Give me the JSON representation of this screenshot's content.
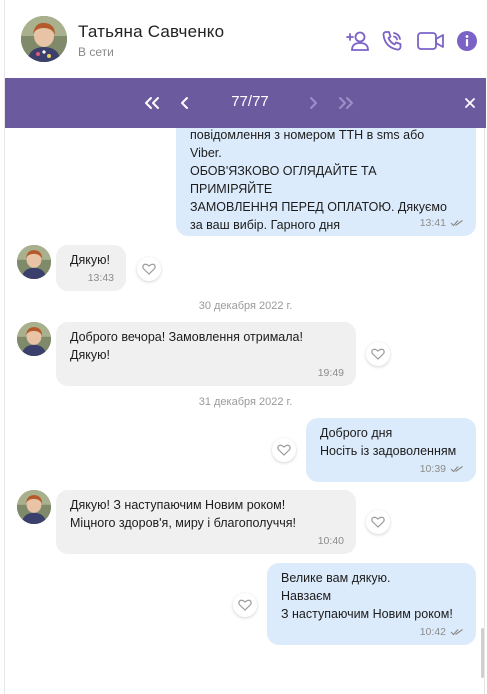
{
  "header": {
    "contact_name": "Татьяна Савченко",
    "contact_status": "В сети",
    "icons": [
      "add-contact-icon",
      "phone-icon",
      "video-icon",
      "info-icon"
    ],
    "accent_color": "#7b62c7"
  },
  "search": {
    "counter": "77/77",
    "bar_color": "#6b5a9e"
  },
  "messages": [
    {
      "direction": "out",
      "text": "повідомлення з номером ТТН в sms або\nViber.\nОБОВ'ЯЗКОВО ОГЛЯДАЙТЕ ТА ПРИМІРЯЙТЕ\nЗАМОВЛЕННЯ ПЕРЕД ОПЛАТОЮ. Дякуємо\nза ваш вибір. Гарного дня",
      "time": "13:41",
      "read": true
    },
    {
      "direction": "in",
      "text": "Дякую!",
      "time": "13:43"
    },
    {
      "direction": "in",
      "text": "Доброго вечора! Замовлення отримала!\nДякую!",
      "time": "19:49"
    },
    {
      "direction": "out",
      "text": "Доброго дня\nНосіть із задоволенням",
      "time": "10:39",
      "read": true
    },
    {
      "direction": "in",
      "text": "Дякую! З наступаючим Новим роком!\nМіцного здоров'я, миру і благополуччя!",
      "time": "10:40"
    },
    {
      "direction": "out",
      "text": "Велике вам дякую.\nНавзаєм\nЗ наступаючим Новим роком!",
      "time": "10:42",
      "read": true
    }
  ],
  "date_separators": [
    "30 декабря 2022 г.",
    "31 декабря 2022 г."
  ]
}
